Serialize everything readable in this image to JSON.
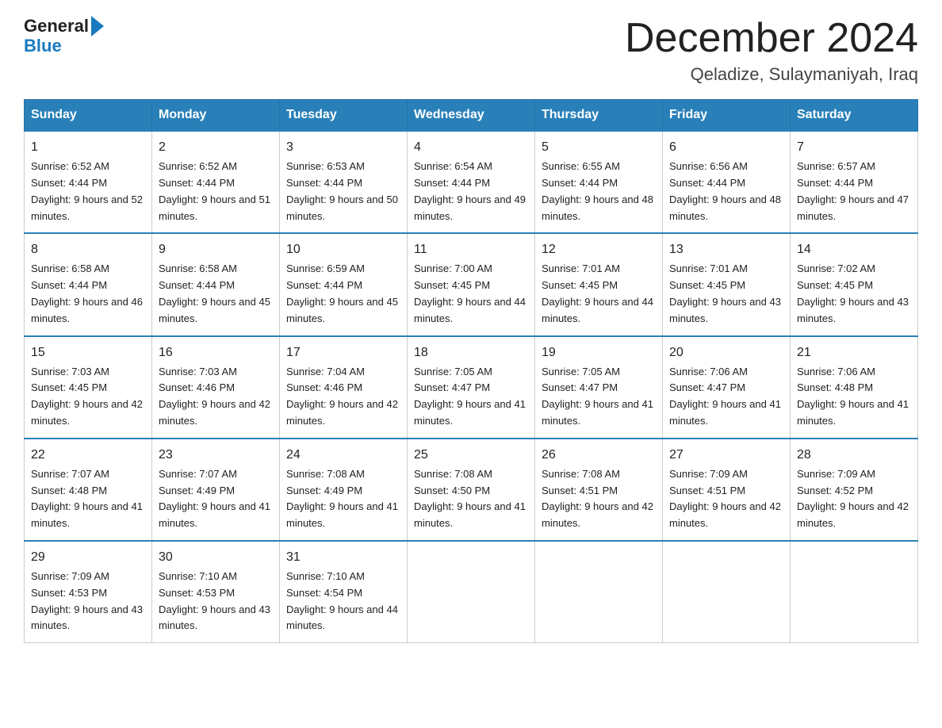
{
  "header": {
    "logo_text_black": "General",
    "logo_text_blue": "Blue",
    "month_title": "December 2024",
    "location": "Qeladize, Sulaymaniyah, Iraq"
  },
  "days_of_week": [
    "Sunday",
    "Monday",
    "Tuesday",
    "Wednesday",
    "Thursday",
    "Friday",
    "Saturday"
  ],
  "weeks": [
    [
      {
        "day": "1",
        "sunrise": "6:52 AM",
        "sunset": "4:44 PM",
        "daylight": "9 hours and 52 minutes."
      },
      {
        "day": "2",
        "sunrise": "6:52 AM",
        "sunset": "4:44 PM",
        "daylight": "9 hours and 51 minutes."
      },
      {
        "day": "3",
        "sunrise": "6:53 AM",
        "sunset": "4:44 PM",
        "daylight": "9 hours and 50 minutes."
      },
      {
        "day": "4",
        "sunrise": "6:54 AM",
        "sunset": "4:44 PM",
        "daylight": "9 hours and 49 minutes."
      },
      {
        "day": "5",
        "sunrise": "6:55 AM",
        "sunset": "4:44 PM",
        "daylight": "9 hours and 48 minutes."
      },
      {
        "day": "6",
        "sunrise": "6:56 AM",
        "sunset": "4:44 PM",
        "daylight": "9 hours and 48 minutes."
      },
      {
        "day": "7",
        "sunrise": "6:57 AM",
        "sunset": "4:44 PM",
        "daylight": "9 hours and 47 minutes."
      }
    ],
    [
      {
        "day": "8",
        "sunrise": "6:58 AM",
        "sunset": "4:44 PM",
        "daylight": "9 hours and 46 minutes."
      },
      {
        "day": "9",
        "sunrise": "6:58 AM",
        "sunset": "4:44 PM",
        "daylight": "9 hours and 45 minutes."
      },
      {
        "day": "10",
        "sunrise": "6:59 AM",
        "sunset": "4:44 PM",
        "daylight": "9 hours and 45 minutes."
      },
      {
        "day": "11",
        "sunrise": "7:00 AM",
        "sunset": "4:45 PM",
        "daylight": "9 hours and 44 minutes."
      },
      {
        "day": "12",
        "sunrise": "7:01 AM",
        "sunset": "4:45 PM",
        "daylight": "9 hours and 44 minutes."
      },
      {
        "day": "13",
        "sunrise": "7:01 AM",
        "sunset": "4:45 PM",
        "daylight": "9 hours and 43 minutes."
      },
      {
        "day": "14",
        "sunrise": "7:02 AM",
        "sunset": "4:45 PM",
        "daylight": "9 hours and 43 minutes."
      }
    ],
    [
      {
        "day": "15",
        "sunrise": "7:03 AM",
        "sunset": "4:45 PM",
        "daylight": "9 hours and 42 minutes."
      },
      {
        "day": "16",
        "sunrise": "7:03 AM",
        "sunset": "4:46 PM",
        "daylight": "9 hours and 42 minutes."
      },
      {
        "day": "17",
        "sunrise": "7:04 AM",
        "sunset": "4:46 PM",
        "daylight": "9 hours and 42 minutes."
      },
      {
        "day": "18",
        "sunrise": "7:05 AM",
        "sunset": "4:47 PM",
        "daylight": "9 hours and 41 minutes."
      },
      {
        "day": "19",
        "sunrise": "7:05 AM",
        "sunset": "4:47 PM",
        "daylight": "9 hours and 41 minutes."
      },
      {
        "day": "20",
        "sunrise": "7:06 AM",
        "sunset": "4:47 PM",
        "daylight": "9 hours and 41 minutes."
      },
      {
        "day": "21",
        "sunrise": "7:06 AM",
        "sunset": "4:48 PM",
        "daylight": "9 hours and 41 minutes."
      }
    ],
    [
      {
        "day": "22",
        "sunrise": "7:07 AM",
        "sunset": "4:48 PM",
        "daylight": "9 hours and 41 minutes."
      },
      {
        "day": "23",
        "sunrise": "7:07 AM",
        "sunset": "4:49 PM",
        "daylight": "9 hours and 41 minutes."
      },
      {
        "day": "24",
        "sunrise": "7:08 AM",
        "sunset": "4:49 PM",
        "daylight": "9 hours and 41 minutes."
      },
      {
        "day": "25",
        "sunrise": "7:08 AM",
        "sunset": "4:50 PM",
        "daylight": "9 hours and 41 minutes."
      },
      {
        "day": "26",
        "sunrise": "7:08 AM",
        "sunset": "4:51 PM",
        "daylight": "9 hours and 42 minutes."
      },
      {
        "day": "27",
        "sunrise": "7:09 AM",
        "sunset": "4:51 PM",
        "daylight": "9 hours and 42 minutes."
      },
      {
        "day": "28",
        "sunrise": "7:09 AM",
        "sunset": "4:52 PM",
        "daylight": "9 hours and 42 minutes."
      }
    ],
    [
      {
        "day": "29",
        "sunrise": "7:09 AM",
        "sunset": "4:53 PM",
        "daylight": "9 hours and 43 minutes."
      },
      {
        "day": "30",
        "sunrise": "7:10 AM",
        "sunset": "4:53 PM",
        "daylight": "9 hours and 43 minutes."
      },
      {
        "day": "31",
        "sunrise": "7:10 AM",
        "sunset": "4:54 PM",
        "daylight": "9 hours and 44 minutes."
      },
      null,
      null,
      null,
      null
    ]
  ]
}
